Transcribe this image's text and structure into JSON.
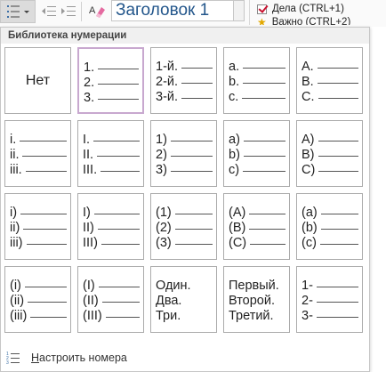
{
  "ribbon": {
    "style_name": "Заголовок 1",
    "tags": [
      {
        "label": "Дела (CTRL+1)"
      },
      {
        "label": "Важно (CTRL+2)"
      }
    ]
  },
  "panel": {
    "title": "Библиотека нумерации",
    "none_label": "Нет",
    "formats": [
      {
        "markers": [
          "1.",
          "2.",
          "3."
        ],
        "selected": true
      },
      {
        "markers": [
          "1-й.",
          "2-й.",
          "3-й."
        ]
      },
      {
        "markers": [
          "a.",
          "b.",
          "c."
        ]
      },
      {
        "markers": [
          "A.",
          "B.",
          "C."
        ]
      },
      {
        "markers": [
          "i.",
          "ii.",
          "iii."
        ]
      },
      {
        "markers": [
          "I.",
          "II.",
          "III."
        ]
      },
      {
        "markers": [
          "1)",
          "2)",
          "3)"
        ]
      },
      {
        "markers": [
          "a)",
          "b)",
          "c)"
        ]
      },
      {
        "markers": [
          "A)",
          "B)",
          "C)"
        ]
      },
      {
        "markers": [
          "i)",
          "ii)",
          "iii)"
        ]
      },
      {
        "markers": [
          "I)",
          "II)",
          "III)"
        ]
      },
      {
        "markers": [
          "(1)",
          "(2)",
          "(3)"
        ]
      },
      {
        "markers": [
          "(A)",
          "(B)",
          "(C)"
        ]
      },
      {
        "markers": [
          "(a)",
          "(b)",
          "(c)"
        ]
      },
      {
        "markers": [
          "(i)",
          "(ii)",
          "(iii)"
        ]
      },
      {
        "markers": [
          "(I)",
          "(II)",
          "(III)"
        ]
      },
      {
        "markers": [
          "Один.",
          "Два.",
          "Три."
        ],
        "word": true
      },
      {
        "markers": [
          "Первый.",
          "Второй.",
          "Третий."
        ],
        "word": true
      },
      {
        "markers": [
          "1-",
          "2-",
          "3-"
        ]
      }
    ]
  },
  "footer": {
    "customize_label_first": "Н",
    "customize_label_rest": "астроить номера"
  },
  "colors": {
    "selected_border": "#c8a8cf",
    "style_text": "#23568b",
    "check_mark": "#c8102e"
  },
  "icons": {
    "numbering": "numbering-icon",
    "indent": "increase-indent-icon",
    "outdent": "decrease-indent-icon",
    "clear_format": "clear-formatting-icon",
    "tag_check": "checkbox-tag-icon",
    "tag_star": "star-tag-icon",
    "customize": "numbering-settings-icon"
  }
}
